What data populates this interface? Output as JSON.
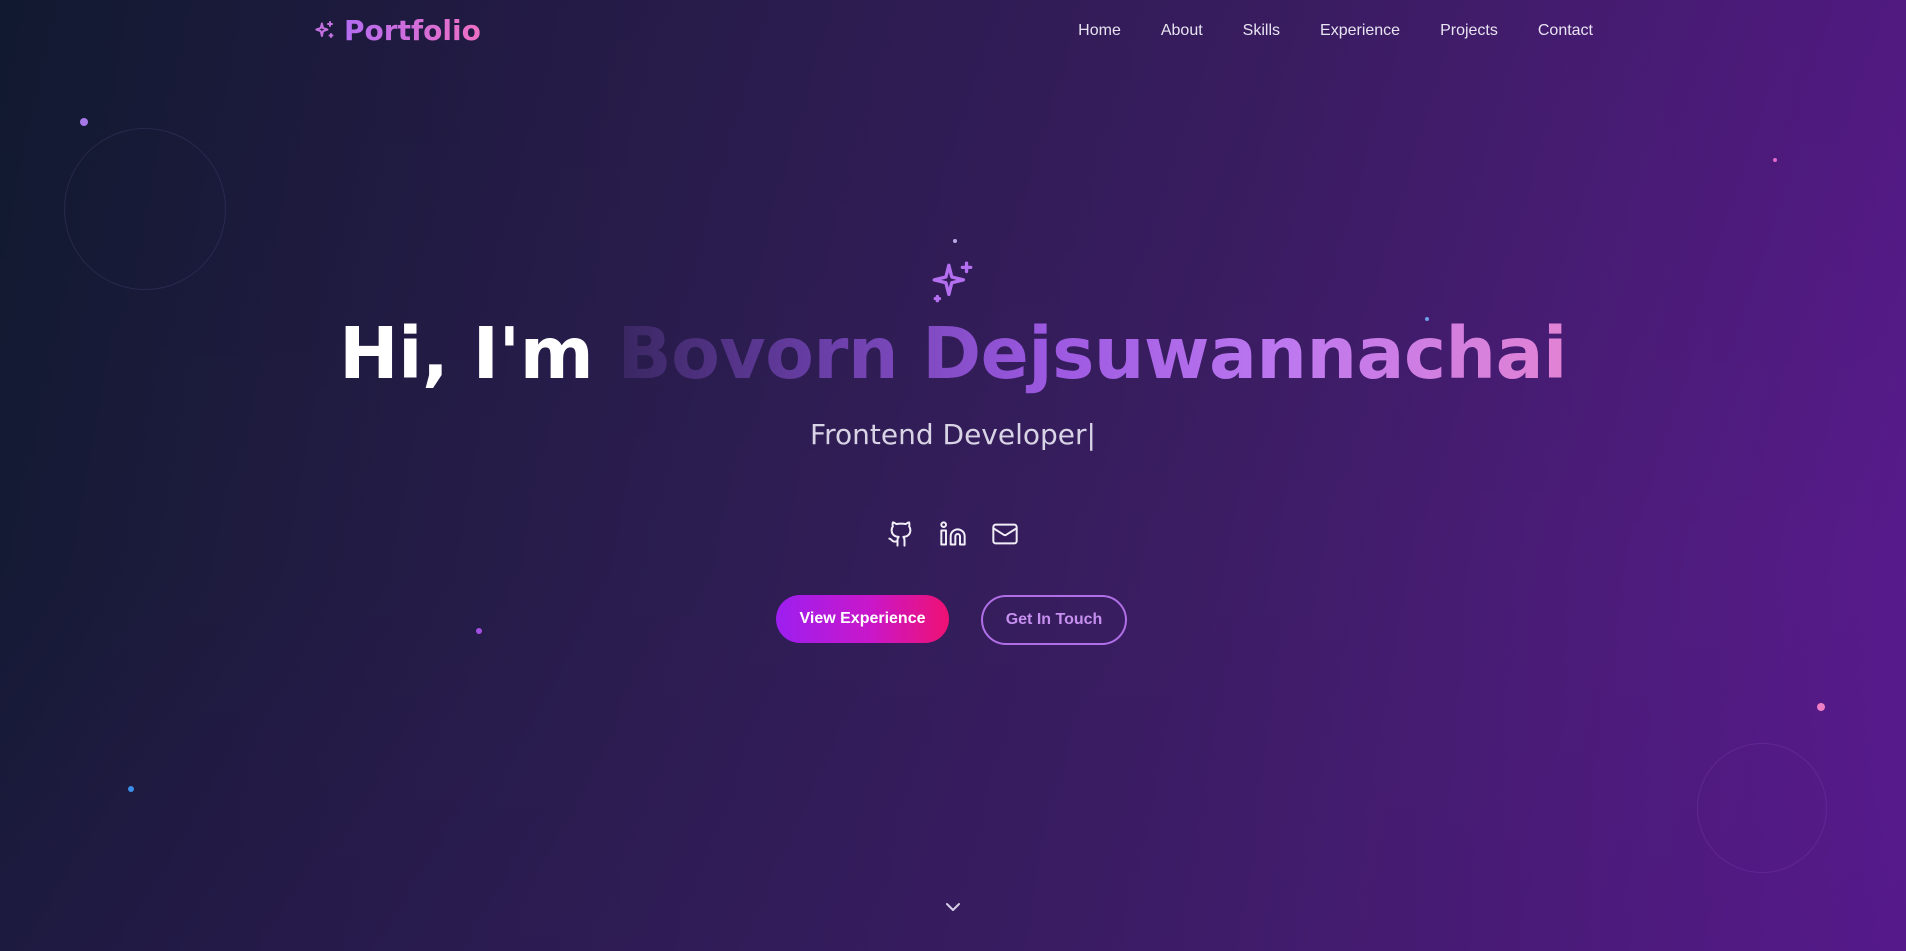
{
  "nav": {
    "brand": "Portfolio",
    "brand_icon": "sparkles-icon",
    "links": [
      "Home",
      "About",
      "Skills",
      "Experience",
      "Projects",
      "Contact"
    ]
  },
  "hero": {
    "icon": "sparkles-icon",
    "greeting": "Hi, I'm ",
    "name": "Bovorn Dejsuwannachai",
    "role": "Frontend Developer|",
    "socials": [
      "github-icon",
      "linkedin-icon",
      "mail-icon"
    ],
    "primary_button": "View Experience",
    "secondary_button": "Get In Touch",
    "scroll_icon": "chevron-down-icon"
  },
  "colors": {
    "accent_purple": "#a855f7",
    "accent_pink": "#ec4899",
    "background_dark": "#111a30",
    "background_violet": "#5a1a8f"
  }
}
